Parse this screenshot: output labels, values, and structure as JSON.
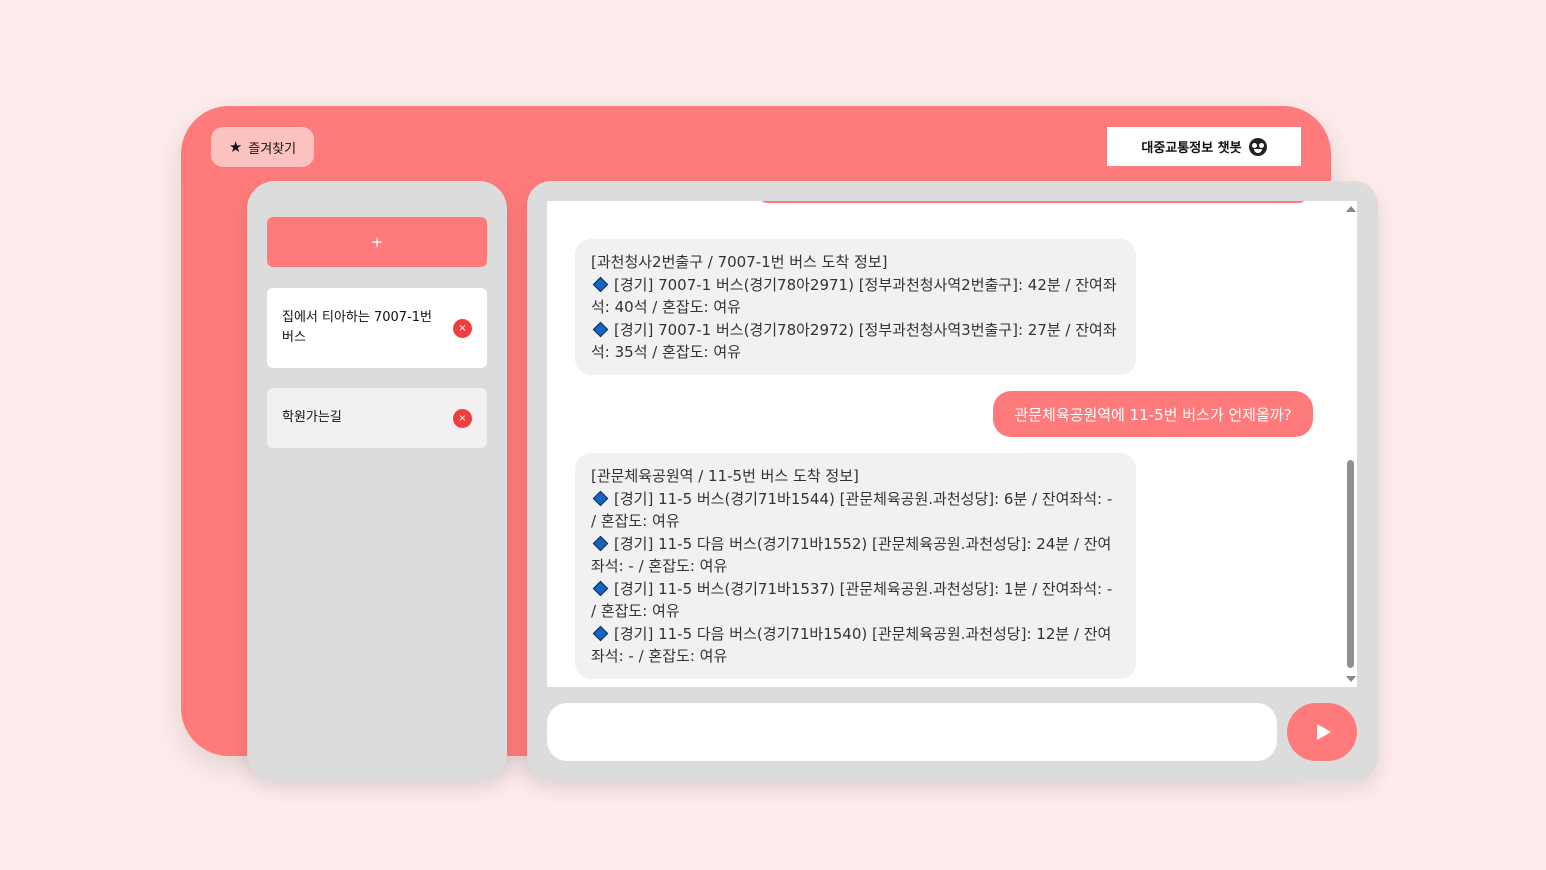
{
  "header": {
    "favorites_label": "즐겨찾기",
    "star_glyph": "★",
    "app_title": "대중교통정보 챗봇"
  },
  "sidebar": {
    "add_label": "+",
    "items": [
      {
        "label": "집에서 티아하는 7007-1번 버스",
        "delete_glyph": "×"
      },
      {
        "label": "학원가는길",
        "delete_glyph": "×"
      }
    ]
  },
  "chat": {
    "messages": [
      {
        "role": "bot",
        "lines": [
          "[과천청사2번출구 / 7007-1번 버스 도착 정보]",
          "[경기] 7007-1 버스(경기78아2971) [정부과천청사역2번출구]: 42분 / 잔여좌석: 40석 / 혼잡도: 여유",
          "[경기] 7007-1 버스(경기78아2972) [정부과천청사역3번출구]: 27분 / 잔여좌석: 35석 / 혼잡도: 여유"
        ]
      },
      {
        "role": "user",
        "text": "관문체육공원역에 11-5번 버스가 언제올까?"
      },
      {
        "role": "bot",
        "lines": [
          "[관문체육공원역 / 11-5번 버스 도착 정보]",
          "[경기] 11-5 버스(경기71바1544) [관문체육공원.과천성당]: 6분 / 잔여좌석: - / 혼잡도: 여유",
          "[경기] 11-5 다음 버스(경기71바1552) [관문체육공원.과천성당]: 24분 / 잔여좌석: - / 혼잡도: 여유",
          "[경기] 11-5 버스(경기71바1537) [관문체육공원.과천성당]: 1분 / 잔여좌석: - / 혼잡도: 여유",
          "[경기] 11-5 다음 버스(경기71바1540) [관문체육공원.과천성당]: 12분 / 잔여좌석: - / 혼잡도: 여유"
        ]
      }
    ]
  },
  "input": {
    "value": "",
    "placeholder": ""
  },
  "colors": {
    "accent": "#ff7b7b",
    "page_bg": "#fdeceb",
    "panel_bg": "#dcdcdc",
    "bubble_bg": "#f1f1f1",
    "delete_red": "#f23d3d",
    "diamond_blue": "#1565c0"
  },
  "icons": {
    "favorites": "star-icon",
    "title": "bot-face-icon",
    "delete": "close-circle-icon",
    "bullet": "blue-diamond-icon",
    "send": "play-icon"
  }
}
